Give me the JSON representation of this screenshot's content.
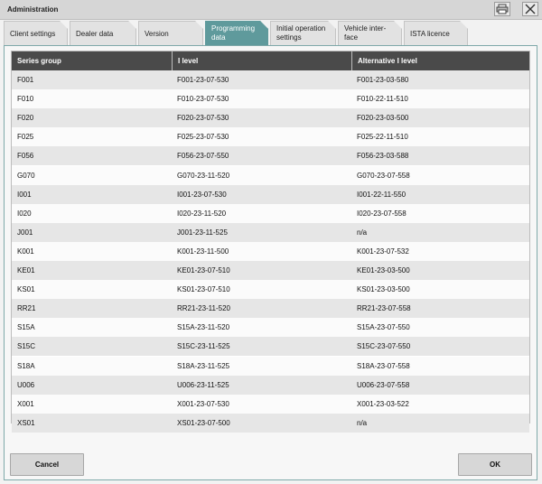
{
  "window": {
    "title": "Administration"
  },
  "tabs": [
    {
      "line1": "Client settings",
      "line2": ""
    },
    {
      "line1": "Dealer data",
      "line2": ""
    },
    {
      "line1": "Version",
      "line2": ""
    },
    {
      "line1": "Programming",
      "line2": "data"
    },
    {
      "line1": "Initial operation",
      "line2": "settings"
    },
    {
      "line1": "Vehicle inter-",
      "line2": "face"
    },
    {
      "line1": "ISTA licence",
      "line2": ""
    }
  ],
  "active_tab": 3,
  "table": {
    "headers": [
      "Series group",
      "I level",
      "Alternative I level"
    ],
    "rows": [
      [
        "F001",
        "F001-23-07-530",
        "F001-23-03-580"
      ],
      [
        "F010",
        "F010-23-07-530",
        "F010-22-11-510"
      ],
      [
        "F020",
        "F020-23-07-530",
        "F020-23-03-500"
      ],
      [
        "F025",
        "F025-23-07-530",
        "F025-22-11-510"
      ],
      [
        "F056",
        "F056-23-07-550",
        "F056-23-03-588"
      ],
      [
        "G070",
        "G070-23-11-520",
        "G070-23-07-558"
      ],
      [
        "I001",
        "I001-23-07-530",
        "I001-22-11-550"
      ],
      [
        "I020",
        "I020-23-11-520",
        "I020-23-07-558"
      ],
      [
        "J001",
        "J001-23-11-525",
        "n/a"
      ],
      [
        "K001",
        "K001-23-11-500",
        "K001-23-07-532"
      ],
      [
        "KE01",
        "KE01-23-07-510",
        "KE01-23-03-500"
      ],
      [
        "KS01",
        "KS01-23-07-510",
        "KS01-23-03-500"
      ],
      [
        "RR21",
        "RR21-23-11-520",
        "RR21-23-07-558"
      ],
      [
        "S15A",
        "S15A-23-11-520",
        "S15A-23-07-550"
      ],
      [
        "S15C",
        "S15C-23-11-525",
        "S15C-23-07-550"
      ],
      [
        "S18A",
        "S18A-23-11-525",
        "S18A-23-07-558"
      ],
      [
        "U006",
        "U006-23-11-525",
        "U006-23-07-558"
      ],
      [
        "X001",
        "X001-23-07-530",
        "X001-23-03-522"
      ],
      [
        "XS01",
        "XS01-23-07-500",
        "n/a"
      ]
    ]
  },
  "buttons": {
    "cancel": "Cancel",
    "ok": "OK"
  },
  "icons": {
    "print": "printer-icon",
    "close": "close-icon"
  },
  "colors": {
    "active_tab": "#5f9a9c",
    "header_bg": "#4a4a4a"
  }
}
